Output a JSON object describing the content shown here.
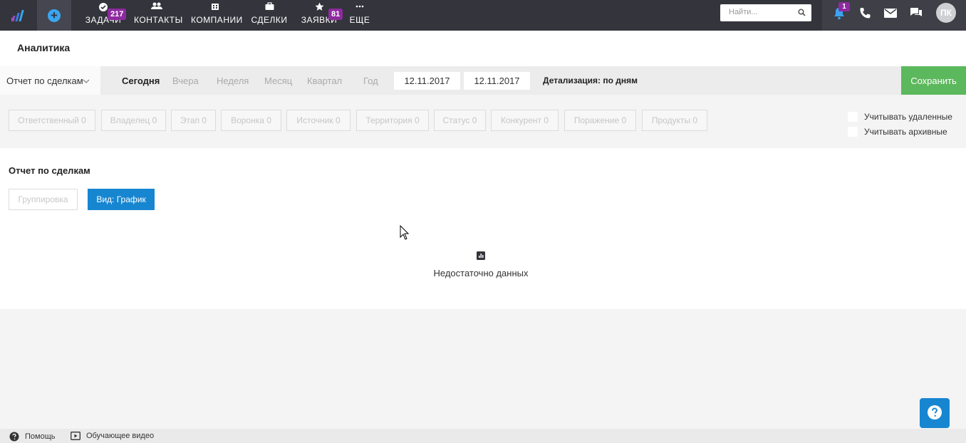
{
  "topbar": {
    "nav": [
      {
        "label": "ЗАДАЧИ",
        "icon": "check-circle-icon",
        "badge": "217"
      },
      {
        "label": "КОНТАКТЫ",
        "icon": "people-icon"
      },
      {
        "label": "КОМПАНИИ",
        "icon": "building-icon"
      },
      {
        "label": "СДЕЛКИ",
        "icon": "briefcase-icon"
      },
      {
        "label": "ЗАЯВКИ",
        "icon": "star-icon",
        "badge": "81"
      },
      {
        "label": "ЕЩЕ",
        "icon": "more-icon"
      }
    ],
    "search_placeholder": "Найти...",
    "notifications_count": "1",
    "avatar_initials": "ПК"
  },
  "page": {
    "title": "Аналитика"
  },
  "filter": {
    "report_type": "Отчет по сделкам",
    "periods": [
      "Сегодня",
      "Вчера",
      "Неделя",
      "Месяц",
      "Квартал",
      "Год"
    ],
    "active_period": "Сегодня",
    "date_from": "12.11.2017",
    "date_to": "12.11.2017",
    "detail": "Детализация: по дням",
    "save_label": "Сохранить"
  },
  "chips": [
    "Ответственный 0",
    "Владелец 0",
    "Этап 0",
    "Воронка 0",
    "Источник 0",
    "Территория 0",
    "Статус 0",
    "Конкурент 0",
    "Поражение 0",
    "Продукты 0"
  ],
  "options": {
    "deleted_label": "Учитывать удаленные",
    "archived_label": "Учитывать архивные"
  },
  "report": {
    "title": "Отчет по сделкам",
    "group_label": "Группировка",
    "view_label": "Вид: График",
    "empty_text": "Недостаточно данных"
  },
  "footer": {
    "help_label": "Помощь",
    "video_label": "Обучающее видео"
  },
  "colors": {
    "topbar": "#34343c",
    "accent_blue": "#1786d1",
    "save_green": "#5cb85c",
    "badge_purple": "#8e2aa0"
  }
}
